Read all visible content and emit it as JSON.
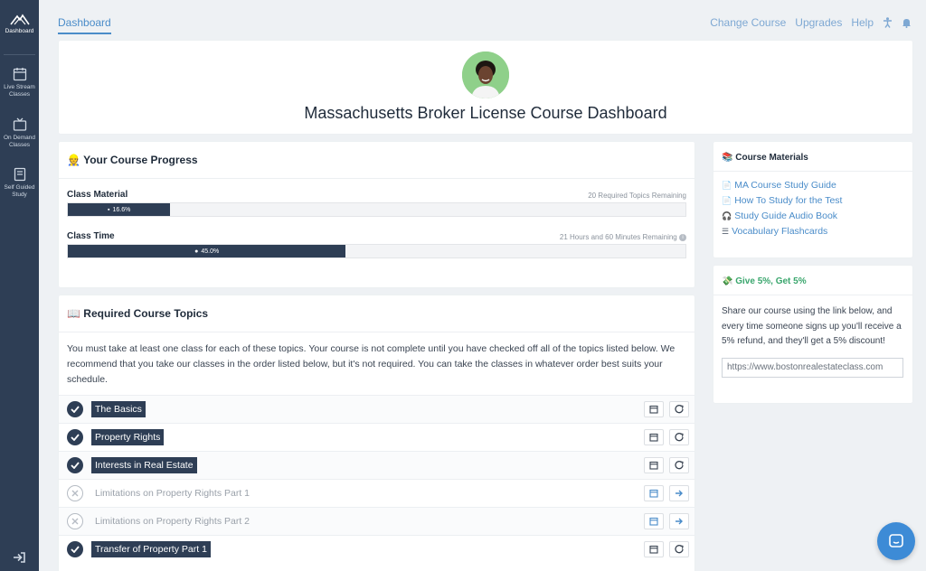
{
  "sidebar": {
    "dashboard_label": "Dashboard",
    "live_stream_label": "Live Stream Classes",
    "on_demand_label": "On Demand Classes",
    "self_guided_label": "Self Guided Study"
  },
  "topnav": {
    "dashboard": "Dashboard",
    "change_course": "Change Course",
    "upgrades": "Upgrades",
    "help": "Help"
  },
  "header": {
    "title": "Massachusetts Broker License Course Dashboard"
  },
  "progress": {
    "title_icon": "👷",
    "title": "Your Course Progress",
    "class_material": {
      "label": "Class Material",
      "remaining": "20 Required Topics Remaining",
      "percent_text": "16.6%",
      "percent": 16.6
    },
    "class_time": {
      "label": "Class Time",
      "remaining": "21 Hours and 60 Minutes Remaining",
      "percent_text": "45.0%",
      "percent": 45.0
    }
  },
  "topics": {
    "title_icon": "📖",
    "title": "Required Course Topics",
    "description": "You must take at least one class for each of these topics. Your course is not complete until you have checked off all of the topics listed below. We recommend that you take our classes in the order listed below, but it's not required. You can take the classes in whatever order best suits your schedule.",
    "items": [
      {
        "label": "The Basics",
        "done": true
      },
      {
        "label": "Property Rights",
        "done": true
      },
      {
        "label": "Interests in Real Estate",
        "done": true
      },
      {
        "label": "Limitations on Property Rights Part 1",
        "done": false
      },
      {
        "label": "Limitations on Property Rights Part 2",
        "done": false
      },
      {
        "label": "Transfer of Property Part 1",
        "done": true
      }
    ]
  },
  "materials": {
    "title_icon": "📚",
    "title": "Course Materials",
    "links": [
      {
        "icon": "document-icon",
        "glyph": "📄",
        "label": "MA Course Study Guide"
      },
      {
        "icon": "document-icon",
        "glyph": "📄",
        "label": "How To Study for the Test"
      },
      {
        "icon": "headphones-icon",
        "glyph": "🎧",
        "label": "Study Guide Audio Book"
      },
      {
        "icon": "layers-icon",
        "glyph": "☰",
        "label": "Vocabulary Flashcards"
      }
    ]
  },
  "referral": {
    "title_icon": "💸",
    "title": "Give 5%, Get 5%",
    "text": "Share our course using the link below, and every time someone signs up you'll receive a 5% refund, and they'll get a 5% discount!",
    "link_value": "https://www.bostonrealestateclass.com"
  },
  "colors": {
    "sidebar": "#2e3e55",
    "accent": "#4a8cc9",
    "success": "#3aa66d",
    "chat": "#3d8bd6"
  }
}
